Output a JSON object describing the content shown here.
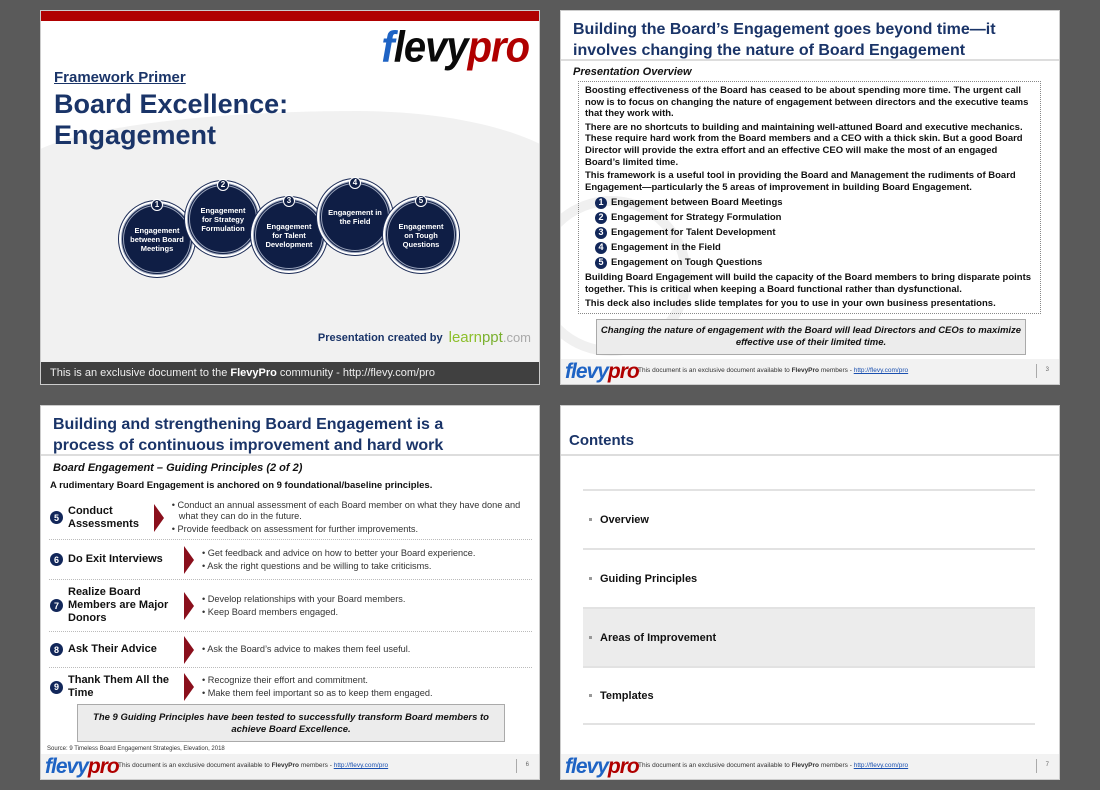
{
  "slide1": {
    "logo": {
      "part1": "f",
      "part2": "levy",
      "part3": "pro"
    },
    "kicker": "Framework Primer",
    "title_line1": "Board Excellence:",
    "title_line2": "Engagement",
    "circles": [
      {
        "num": "1",
        "label": "Engagement between Board Meetings"
      },
      {
        "num": "2",
        "label": "Engagement for Strategy Formulation"
      },
      {
        "num": "3",
        "label": "Engagement for Talent Development"
      },
      {
        "num": "4",
        "label": "Engagement in the Field"
      },
      {
        "num": "5",
        "label": "Engagement on Tough Questions"
      }
    ],
    "credit": "Presentation created by",
    "credit_brand": {
      "a": "learn",
      "b": "ppt",
      "c": ".com"
    },
    "footer_pre": "This is an exclusive document to the ",
    "footer_bold": "FlevyPro",
    "footer_post": " community - http://flevy.com/pro"
  },
  "footer": {
    "pre": "This document is an exclusive document available to ",
    "bold": "FlevyPro",
    "mid": " members - ",
    "link": "http://flevy.com/pro"
  },
  "slide2": {
    "title": "Building the Board’s Engagement goes beyond time—it involves changing the nature of Board Engagement",
    "subtitle": "Presentation Overview",
    "paragraphs": [
      "Boosting effectiveness of the Board has ceased to be about spending more time. The urgent call now is to focus on changing the nature of engagement between directors and the executive teams that they work with.",
      "There are no shortcuts to building and maintaining well-attuned Board and executive mechanics. These require hard work from the Board members and a CEO with a thick skin.  But a good Board Director will provide the extra effort and an effective CEO will make the most of an engaged Board’s limited time.",
      "This framework is a useful tool in providing the Board and Management the rudiments of Board Engagement—particularly the 5 areas of improvement in building Board Engagement."
    ],
    "list": [
      {
        "num": "1",
        "label": "Engagement between Board Meetings"
      },
      {
        "num": "2",
        "label": "Engagement for Strategy Formulation"
      },
      {
        "num": "3",
        "label": "Engagement for Talent Development"
      },
      {
        "num": "4",
        "label": "Engagement in the Field"
      },
      {
        "num": "5",
        "label": "Engagement on Tough Questions"
      }
    ],
    "paragraphs_after": [
      "Building Board Engagement will build the capacity of the Board members to bring disparate points together. This is critical when keeping a Board functional rather than dysfunctional.",
      "This deck also includes slide templates for you to use in your own business presentations."
    ],
    "callout": "Changing the nature of engagement with the Board will lead Directors and CEOs to maximize effective use of their limited time.",
    "page": "3"
  },
  "slide3": {
    "title": "Building and strengthening Board Engagement is a process of continuous  improvement and hard work",
    "subtitle": "Board Engagement – Guiding Principles (2 of 2)",
    "lead": "A rudimentary Board Engagement is anchored on 9 foundational/baseline principles.",
    "rows": [
      {
        "num": "5",
        "label": "Conduct Assessments",
        "bullets": [
          "Conduct an annual assessment of each Board member on what they have done and what they can do in the future.",
          "Provide feedback on assessment for further improvements."
        ]
      },
      {
        "num": "6",
        "label": "Do Exit Interviews",
        "bullets": [
          "Get feedback and advice on how to better your Board experience.",
          "Ask the right questions and be willing to take criticisms."
        ]
      },
      {
        "num": "7",
        "label": "Realize Board Members are Major Donors",
        "bullets": [
          "Develop relationships with your Board members.",
          "Keep Board members engaged."
        ]
      },
      {
        "num": "8",
        "label": "Ask Their Advice",
        "bullets": [
          "Ask the Board’s advice to makes them feel useful."
        ]
      },
      {
        "num": "9",
        "label": "Thank Them All the Time",
        "bullets": [
          "Recognize their effort and commitment.",
          "Make them feel important so as to keep them engaged."
        ]
      }
    ],
    "callout": "The 9 Guiding Principles have been tested to successfully transform Board members to achieve Board Excellence.",
    "source": "Source: 9 Timeless Board Engagement Strategies, Elevation, 2018",
    "page": "6"
  },
  "slide4": {
    "title": "Contents",
    "items": [
      {
        "label": "Overview",
        "active": false
      },
      {
        "label": "Guiding Principles",
        "active": false
      },
      {
        "label": "Areas of Improvement",
        "active": true
      },
      {
        "label": "Templates",
        "active": false
      }
    ],
    "page": "7"
  }
}
